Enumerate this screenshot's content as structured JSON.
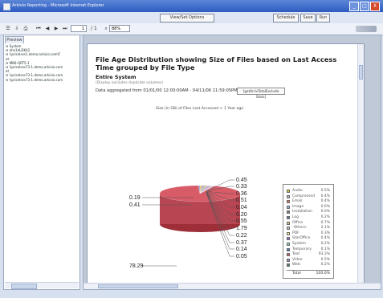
{
  "window": {
    "title": "Arkivio Reporting - Microsoft Internet Explorer",
    "buttons": [
      "_",
      "□",
      "X"
    ]
  },
  "appbar": {
    "view_set_options": "View/Set Options",
    "schedule": "Schedule",
    "save": "Save",
    "run": "Run"
  },
  "toolbar": {
    "page_value": "1",
    "page_total": "/ 1",
    "zoom_value": "88%"
  },
  "left_panel": {
    "tab_label": "Preview",
    "tree": [
      "⊟ System",
      "  ⊟ ahe1dLDKA2",
      "    ⊟ \\\\priceless1.demo.arkivio.com\\F",
      "      at",
      "  ⊟ MB6-QRT5-1",
      "    ⊟ \\\\priceless73-1.demo.arkivio.com",
      "      at",
      "    ⊟ \\\\priceless73-1.demo.arkivio.com",
      "    ⊟ \\\\priceless73-1.demo.arkivio.com"
    ]
  },
  "report": {
    "title": "File Age Distribution showing Size of Files based on Last Access Time grouped by File Type",
    "scope": "Entire System",
    "note": "(Display excludes duplicate volumes)",
    "aggregation_text": "Data aggregated from 01/01/00  12:00:00AM - 04/11/06  11:59:05PM",
    "aggregation_link": "[getArrivTotalExclude Stats]",
    "chart_heading": "Size (in GB) of Files Last Accessed > 1 Year ago"
  },
  "chart_data": {
    "type": "pie",
    "title": "Size (in GB) of Files Last Accessed > 1 Year ago",
    "categories": [
      "Audio",
      "Compressed",
      "Email",
      "Image",
      "Installation",
      "Log",
      "Office",
      "-Others-",
      "PDF",
      "StarOffice",
      "System",
      "Temporary",
      "Text",
      "Video",
      "Web"
    ],
    "percentages": [
      0.5,
      0.4,
      0.4,
      0.6,
      0.0,
      0.2,
      0.7,
      2.1,
      0.3,
      0.4,
      0.2,
      0.1,
      93.3,
      0.5,
      0.2
    ],
    "total_label": "Total",
    "total_value": "100.0%",
    "slice_labels": [
      "0.45",
      "0.33",
      "0.36",
      "0.51",
      "0.04",
      "0.20",
      "0.55",
      "1.79",
      "0.22",
      "0.37",
      "0.14",
      "0.05",
      "78.29",
      "0.19",
      "0.41"
    ]
  },
  "colors": {
    "Audio": "#d3c72d",
    "Compressed": "#b6b6d9",
    "Email": "#e47c64",
    "Image": "#8ea8d9",
    "Installation": "#7f7d7d",
    "Log": "#5e7f9b",
    "Office": "#c6c87c",
    "-Others-": "#cbb4d8",
    "PDF": "#f4f17c",
    "StarOffice": "#9c6ed5",
    "System": "#7fcfc0",
    "Temporary": "#4a7cc3",
    "Text": "#d85b68",
    "Video": "#9a82c4",
    "Web": "#4f7d7f"
  }
}
